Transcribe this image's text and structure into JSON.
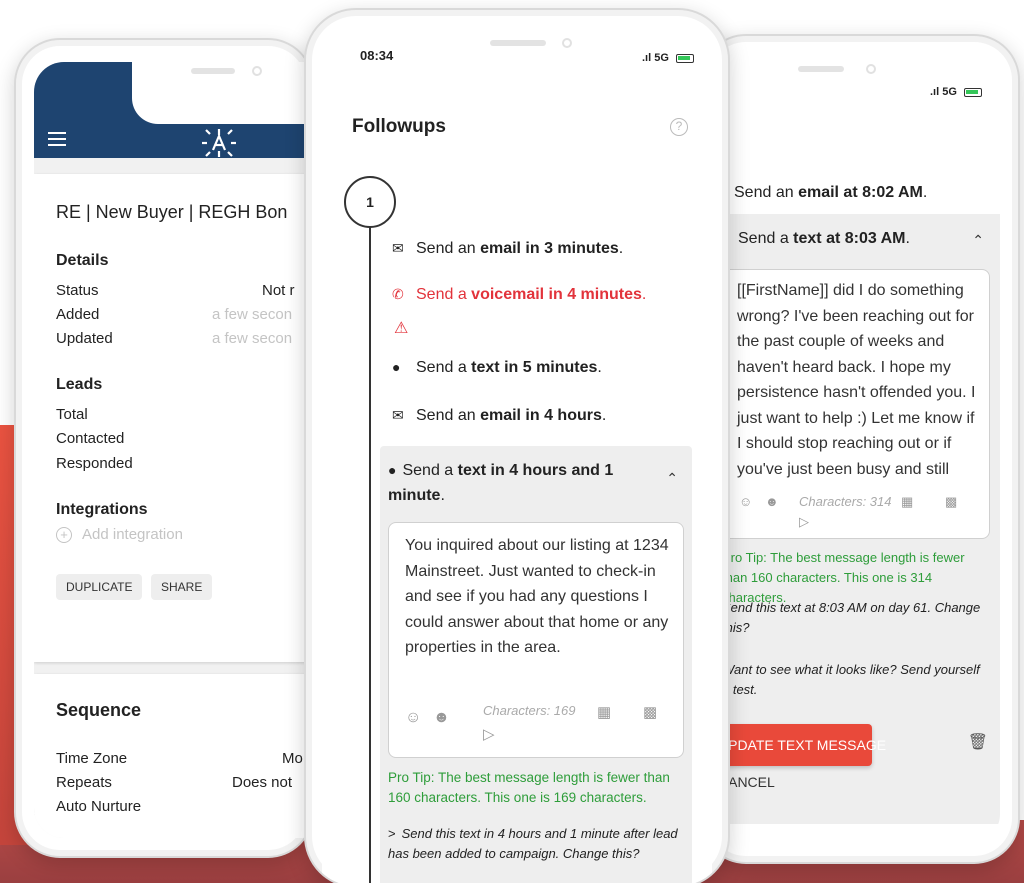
{
  "left_phone": {
    "title": "RE | New Buyer | REGH Bon",
    "details": {
      "heading": "Details",
      "rows": [
        {
          "label": "Status",
          "value": "Not r"
        },
        {
          "label": "Added",
          "value": "a few secon"
        },
        {
          "label": "Updated",
          "value": "a few secon"
        }
      ]
    },
    "leads": {
      "heading": "Leads",
      "rows": [
        {
          "label": "Total"
        },
        {
          "label": "Contacted"
        },
        {
          "label": "Responded"
        }
      ]
    },
    "integrations": {
      "heading": "Integrations",
      "add_label": "Add integration"
    },
    "buttons": {
      "duplicate": "DUPLICATE",
      "share": "SHARE"
    },
    "sequence": {
      "heading": "Sequence",
      "rows": [
        {
          "label": "Time Zone",
          "value": "Mo"
        },
        {
          "label": "Repeats",
          "value": "Does not"
        },
        {
          "label": "Auto Nurture",
          "value": ""
        }
      ]
    }
  },
  "mid_phone": {
    "status": {
      "time": "08:34",
      "network": "5G"
    },
    "title": "Followups",
    "step_number": "1",
    "followups": [
      {
        "icon": "envelope-icon",
        "pre": "Send an",
        "bold": "email in 3 minutes",
        "post": "."
      },
      {
        "icon": "phone-icon",
        "pre": "Send a",
        "bold": "voicemail in 4 minutes",
        "post": "."
      },
      {
        "icon": "chat-icon",
        "pre": "Send a",
        "bold": "text in 5 minutes",
        "post": "."
      },
      {
        "icon": "envelope-icon",
        "pre": "Send an",
        "bold": "email in 4 hours",
        "post": "."
      }
    ],
    "expanded": {
      "pre": "Send a",
      "bold": "text in 4 hours and 1 minute",
      "post": ".",
      "message": "You inquired about our listing at 1234 Mainstreet. Just wanted to check-in and see if you had any questions I could answer about that home or any properties in the area.",
      "characters": "Characters: 169",
      "pro_tip": "Pro Tip: The best message length is fewer than 160 characters. This one is 169 characters.",
      "send_info": "Send this text in 4 hours and 1 minute after lead has been added to campaign. Change this?"
    }
  },
  "right_phone": {
    "status": {
      "network": "5G"
    },
    "line1": {
      "pre": "Send an",
      "bold": "email at 8:02 AM",
      "post": "."
    },
    "expanded": {
      "pre": "Send a",
      "bold": "text at 8:03 AM",
      "post": ".",
      "message": "[[FirstName]] did I do something wrong? I've been reaching out for the past couple of weeks and haven't heard back. I hope my persistence hasn't offended you. I just want to help :) Let me know if I should stop reaching out or if you've just been busy and still",
      "characters": "Characters: 314",
      "pro_tip": "Pro Tip: The best message length is fewer than 160 characters. This one is 314 characters.",
      "send_info": "Send this text at 8:03 AM on day 61. Change this?",
      "preview": "Want to see what it looks like? Send yourself a test.",
      "update_button": "UPDATE TEXT MESSAGE",
      "cancel": "CANCEL"
    }
  }
}
